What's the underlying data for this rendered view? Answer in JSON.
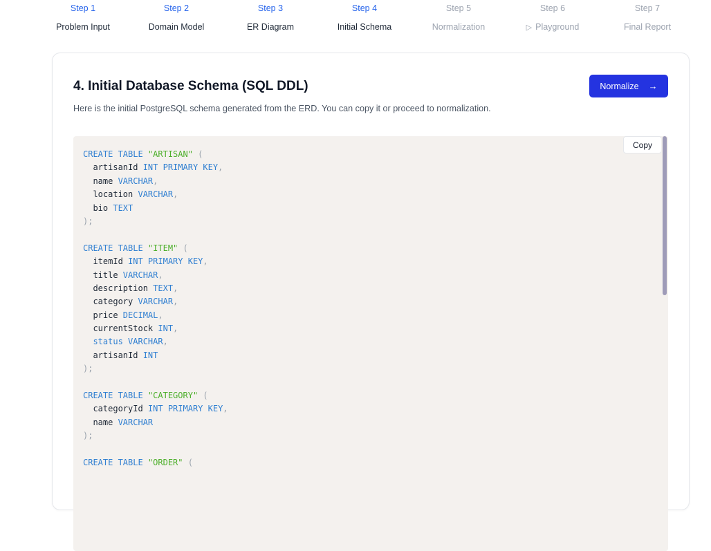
{
  "stepper": {
    "steps": [
      {
        "num": "Step 1",
        "label": "Problem Input"
      },
      {
        "num": "Step 2",
        "label": "Domain Model"
      },
      {
        "num": "Step 3",
        "label": "ER Diagram"
      },
      {
        "num": "Step 4",
        "label": "Initial Schema"
      },
      {
        "num": "Step 5",
        "label": "Normalization"
      },
      {
        "num": "Step 6",
        "label": "Playground"
      },
      {
        "num": "Step 7",
        "label": "Final Report"
      }
    ],
    "current_step": 4
  },
  "main": {
    "title": "4. Initial Database Schema (SQL DDL)",
    "subtitle": "Here is the initial PostgreSQL schema generated from the ERD. You can copy it or proceed to normalization.",
    "normalize_label": "Normalize",
    "normalize_arrow": "→",
    "copy_label": "Copy"
  },
  "code": {
    "lines": [
      [
        {
          "t": "kw",
          "v": "CREATE TABLE "
        },
        {
          "t": "str",
          "v": "\"ARTISAN\""
        },
        {
          "t": "punct",
          "v": " ("
        }
      ],
      [
        {
          "t": "ident",
          "v": "  artisanId "
        },
        {
          "t": "kw",
          "v": "INT PRIMARY KEY"
        },
        {
          "t": "punct",
          "v": ","
        }
      ],
      [
        {
          "t": "ident",
          "v": "  name "
        },
        {
          "t": "kw",
          "v": "VARCHAR"
        },
        {
          "t": "punct",
          "v": ","
        }
      ],
      [
        {
          "t": "ident",
          "v": "  location "
        },
        {
          "t": "kw",
          "v": "VARCHAR"
        },
        {
          "t": "punct",
          "v": ","
        }
      ],
      [
        {
          "t": "ident",
          "v": "  bio "
        },
        {
          "t": "kw",
          "v": "TEXT"
        }
      ],
      [
        {
          "t": "punct",
          "v": ");"
        }
      ],
      [],
      [
        {
          "t": "kw",
          "v": "CREATE TABLE "
        },
        {
          "t": "str",
          "v": "\"ITEM\""
        },
        {
          "t": "punct",
          "v": " ("
        }
      ],
      [
        {
          "t": "ident",
          "v": "  itemId "
        },
        {
          "t": "kw",
          "v": "INT PRIMARY KEY"
        },
        {
          "t": "punct",
          "v": ","
        }
      ],
      [
        {
          "t": "ident",
          "v": "  title "
        },
        {
          "t": "kw",
          "v": "VARCHAR"
        },
        {
          "t": "punct",
          "v": ","
        }
      ],
      [
        {
          "t": "ident",
          "v": "  description "
        },
        {
          "t": "kw",
          "v": "TEXT"
        },
        {
          "t": "punct",
          "v": ","
        }
      ],
      [
        {
          "t": "ident",
          "v": "  category "
        },
        {
          "t": "kw",
          "v": "VARCHAR"
        },
        {
          "t": "punct",
          "v": ","
        }
      ],
      [
        {
          "t": "ident",
          "v": "  price "
        },
        {
          "t": "kw",
          "v": "DECIMAL"
        },
        {
          "t": "punct",
          "v": ","
        }
      ],
      [
        {
          "t": "ident",
          "v": "  currentStock "
        },
        {
          "t": "kw",
          "v": "INT"
        },
        {
          "t": "punct",
          "v": ","
        }
      ],
      [
        {
          "t": "ident",
          "v": "  "
        },
        {
          "t": "kw",
          "v": "status VARCHAR"
        },
        {
          "t": "punct",
          "v": ","
        }
      ],
      [
        {
          "t": "ident",
          "v": "  artisanId "
        },
        {
          "t": "kw",
          "v": "INT"
        }
      ],
      [
        {
          "t": "punct",
          "v": ");"
        }
      ],
      [],
      [
        {
          "t": "kw",
          "v": "CREATE TABLE "
        },
        {
          "t": "str",
          "v": "\"CATEGORY\""
        },
        {
          "t": "punct",
          "v": " ("
        }
      ],
      [
        {
          "t": "ident",
          "v": "  categoryId "
        },
        {
          "t": "kw",
          "v": "INT PRIMARY KEY"
        },
        {
          "t": "punct",
          "v": ","
        }
      ],
      [
        {
          "t": "ident",
          "v": "  name "
        },
        {
          "t": "kw",
          "v": "VARCHAR"
        }
      ],
      [
        {
          "t": "punct",
          "v": ");"
        }
      ],
      [],
      [
        {
          "t": "kw",
          "v": "CREATE TABLE "
        },
        {
          "t": "str",
          "v": "\"ORDER\""
        },
        {
          "t": "punct",
          "v": " ("
        }
      ]
    ]
  },
  "colors": {
    "accent": "#2433e0",
    "step_active": "#2563eb",
    "step_upcoming": "#9ca3af",
    "code_background": "#f4f1ee",
    "keyword": "#2f7fd1",
    "string": "#4caf2a"
  },
  "icons": {
    "normalize": "arrow-right-icon",
    "playground": "play-icon"
  }
}
